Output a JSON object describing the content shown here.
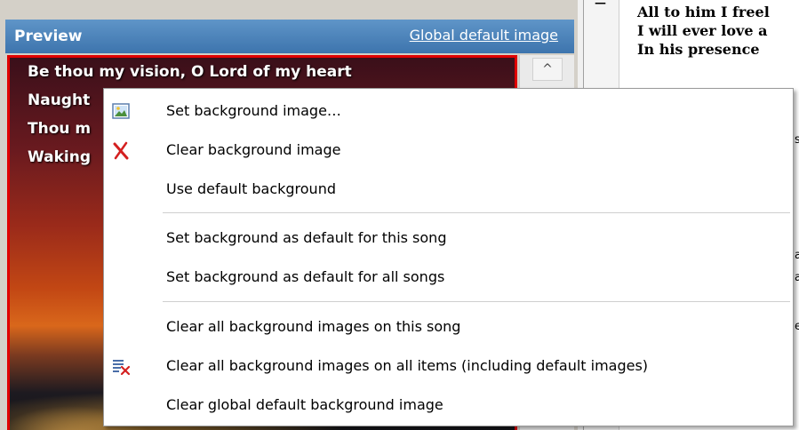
{
  "preview": {
    "title": "Preview",
    "global_link": "Global default image",
    "lyrics": [
      "Be thou my vision, O Lord of my heart",
      "Naught",
      "Thou m",
      "Waking"
    ],
    "scroll_up_glyph": "^"
  },
  "right_pane": {
    "lines": [
      "All to him I freel",
      "I will ever love a",
      "In his presence"
    ],
    "fragments": [
      "s",
      "a",
      "a",
      "e"
    ]
  },
  "context_menu": {
    "items": [
      {
        "label": "Set background image…",
        "icon": "image-icon"
      },
      {
        "label": "Clear background image",
        "icon": "red-x-icon"
      },
      {
        "label": "Use default background",
        "icon": ""
      },
      {
        "label": "Set background as default for this song",
        "icon": ""
      },
      {
        "label": "Set background as default for all songs",
        "icon": ""
      },
      {
        "label": "Clear all background images on this song",
        "icon": ""
      },
      {
        "label": "Clear all background images on all items (including default images)",
        "icon": "clear-list-icon"
      },
      {
        "label": "Clear global default background image",
        "icon": ""
      }
    ]
  },
  "colors": {
    "header_blue": "#4f86bd",
    "slide_border": "#e00000",
    "icon_red": "#d42020"
  }
}
